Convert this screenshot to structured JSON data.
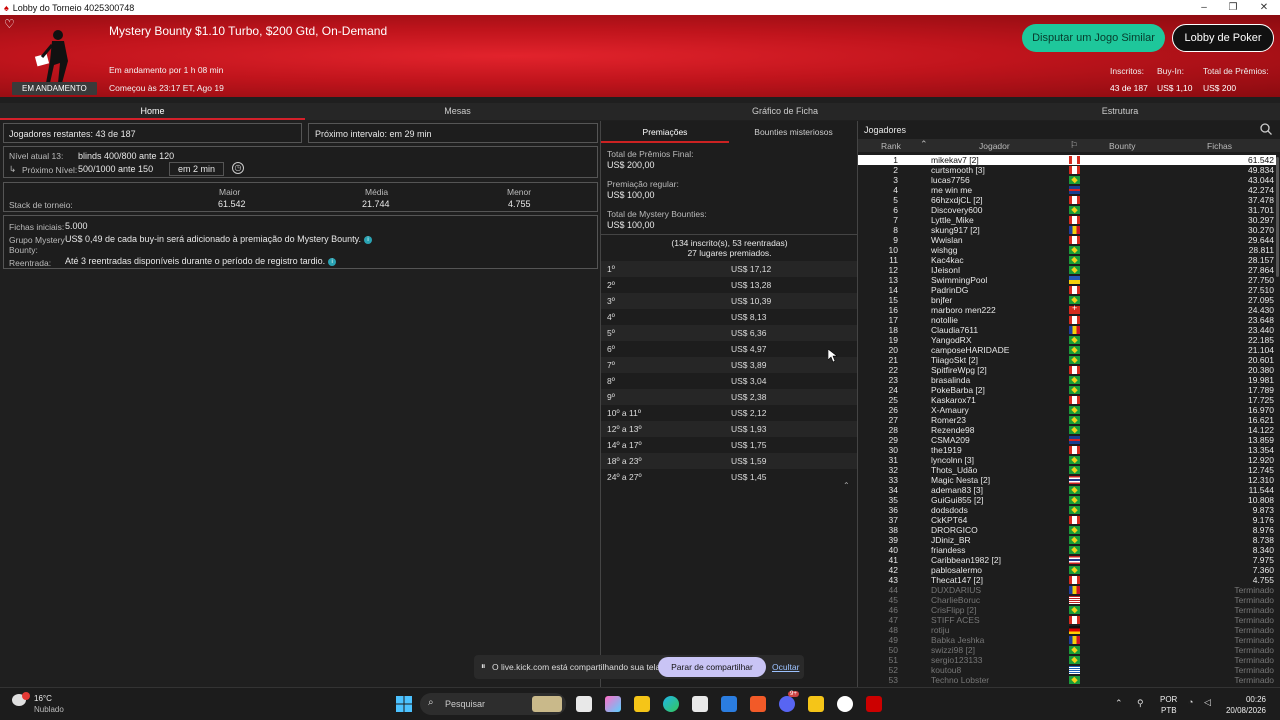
{
  "window": {
    "title": "Lobby do Torneio 4025300748"
  },
  "header": {
    "tournament_title": "Mystery Bounty $1.10 Turbo, $200 Gtd, On-Demand",
    "running_for": "Em andamento por 1 h 08 min",
    "started_at": "Começou às 23:17 ET, Ago 19",
    "status_badge": "EM ANDAMENTO",
    "similar_button": "Disputar um Jogo Similar",
    "poker_lobby_button": "Lobby de Poker",
    "stats": {
      "registered_label": "Inscritos:",
      "registered_value": "43 de 187",
      "buyin_label": "Buy-In:",
      "buyin_value": "US$ 1,10",
      "prize_label": "Total de Prêmios:",
      "prize_value": "US$ 200"
    }
  },
  "tabs": [
    "Home",
    "Mesas",
    "Gráfico de Ficha",
    "Estrutura"
  ],
  "home": {
    "players_remaining": "Jogadores restantes: 43 de 187",
    "next_break": "Próximo intervalo: em 29 min",
    "current_level_label": "Nível atual 13:",
    "current_level_value": "blinds 400/800 ante 120",
    "next_level_label": "Próximo Nível:",
    "next_level_value": "500/1000 ante 150",
    "next_level_time": "em 2 min",
    "stack_label": "Stack de torneio:",
    "stack_headers": [
      "Maior",
      "Média",
      "Menor"
    ],
    "stack_values": [
      "61.542",
      "21.744",
      "4.755"
    ],
    "initial_chips_label": "Fichas iniciais:",
    "initial_chips_value": "5.000",
    "mystery_label": "Grupo Mystery Bounty:",
    "mystery_value": "US$ 0,49 de cada buy-in será adicionado à premiação do Mystery Bounty.",
    "reentry_label": "Reentrada:",
    "reentry_value": "Até 3 reentradas disponíveis durante o período de registro tardio."
  },
  "prizes": {
    "tabs": [
      "Premiações",
      "Bounties misteriosos"
    ],
    "final_label": "Total de Prêmios Final:",
    "final_value": "US$ 200,00",
    "regular_label": "Premiação regular:",
    "regular_value": "US$ 100,00",
    "mystery_label": "Total de Mystery Bounties:",
    "mystery_value": "US$ 100,00",
    "entries_line": "(134 inscrito(s), 53 reentradas)",
    "paid_line": "27 lugares premiados.",
    "rows": [
      [
        "1º",
        "US$ 17,12"
      ],
      [
        "2º",
        "US$ 13,28"
      ],
      [
        "3º",
        "US$ 10,39"
      ],
      [
        "4º",
        "US$ 8,13"
      ],
      [
        "5º",
        "US$ 6,36"
      ],
      [
        "6º",
        "US$ 4,97"
      ],
      [
        "7º",
        "US$ 3,89"
      ],
      [
        "8º",
        "US$ 3,04"
      ],
      [
        "9º",
        "US$ 2,38"
      ],
      [
        "10º a 11º",
        "US$ 2,12"
      ],
      [
        "12º a 13º",
        "US$ 1,93"
      ],
      [
        "14º a 17º",
        "US$ 1,75"
      ],
      [
        "18º a 23º",
        "US$ 1,59"
      ],
      [
        "24º a 27º",
        "US$ 1,45"
      ]
    ]
  },
  "players": {
    "title": "Jogadores",
    "headers": {
      "rank": "Rank",
      "player": "Jogador",
      "bounty": "Bounty",
      "chips": "Fichas"
    },
    "rows": [
      [
        "1",
        "mikekav7 [2]",
        "ca",
        "61.542"
      ],
      [
        "2",
        "curtsmooth [3]",
        "ca",
        "49.834"
      ],
      [
        "3",
        "lucas7756",
        "br",
        "43.044"
      ],
      [
        "4",
        "me win me",
        "gb",
        "42.274"
      ],
      [
        "5",
        "66hzxdjCL [2]",
        "ca",
        "37.478"
      ],
      [
        "6",
        "Discovery600",
        "br",
        "31.701"
      ],
      [
        "7",
        "Lyttle_Mike",
        "ca",
        "30.297"
      ],
      [
        "8",
        "skung917 [2]",
        "ro",
        "30.270"
      ],
      [
        "9",
        "Wwislan",
        "ca",
        "29.644"
      ],
      [
        "10",
        "wishgg",
        "br",
        "28.811"
      ],
      [
        "11",
        "Kac4kac",
        "br",
        "28.157"
      ],
      [
        "12",
        "IJeisonI",
        "br",
        "27.864"
      ],
      [
        "13",
        "SwimmingPool",
        "ua",
        "27.750"
      ],
      [
        "14",
        "PadrinDG",
        "ca",
        "27.510"
      ],
      [
        "15",
        "bnjfer",
        "br",
        "27.095"
      ],
      [
        "16",
        "marboro men222",
        "ch",
        "24.430"
      ],
      [
        "17",
        "notollie",
        "ca",
        "23.648"
      ],
      [
        "18",
        "Claudia7611",
        "ro",
        "23.440"
      ],
      [
        "19",
        "YangodRX",
        "br",
        "22.185"
      ],
      [
        "20",
        "camposeHARIDADE",
        "br",
        "21.104"
      ],
      [
        "21",
        "TiiagoSkt [2]",
        "br",
        "20.601"
      ],
      [
        "22",
        "SpitfireWpg [2]",
        "ca",
        "20.380"
      ],
      [
        "23",
        "brasalinda",
        "br",
        "19.981"
      ],
      [
        "24",
        "PokeBarba [2]",
        "br",
        "17.789"
      ],
      [
        "25",
        "Kaskarox71",
        "ca",
        "17.725"
      ],
      [
        "26",
        "X-Amaury",
        "br",
        "16.970"
      ],
      [
        "27",
        "Romer23",
        "br",
        "16.621"
      ],
      [
        "28",
        "Rezende98",
        "br",
        "14.122"
      ],
      [
        "29",
        "CSMA209",
        "gb",
        "13.859"
      ],
      [
        "30",
        "the1919",
        "ca",
        "13.354"
      ],
      [
        "31",
        "lyncolnn [3]",
        "br",
        "12.920"
      ],
      [
        "32",
        "Thots_Udão",
        "br",
        "12.745"
      ],
      [
        "33",
        "Magic Nesta [2]",
        "th",
        "12.310"
      ],
      [
        "34",
        "ademan83 [3]",
        "br",
        "11.544"
      ],
      [
        "35",
        "GuiGui855 [2]",
        "br",
        "10.808"
      ],
      [
        "36",
        "dodsdods",
        "br",
        "9.873"
      ],
      [
        "37",
        "CkKPT64",
        "ca",
        "9.176"
      ],
      [
        "38",
        "DRORGICO",
        "br",
        "8.976"
      ],
      [
        "39",
        "JDiniz_BR",
        "br",
        "8.738"
      ],
      [
        "40",
        "friandess",
        "br",
        "8.340"
      ],
      [
        "41",
        "Caribbean1982 [2]",
        "th",
        "7.975"
      ],
      [
        "42",
        "pablosalermo",
        "br",
        "7.360"
      ],
      [
        "43",
        "Thecat147 [2]",
        "ca",
        "4.755"
      ],
      [
        "44",
        "DUXDARIUS",
        "ro",
        "Terminado"
      ],
      [
        "45",
        "CharlieBoruc",
        "us",
        "Terminado"
      ],
      [
        "46",
        "CrisFlipp [2]",
        "br",
        "Terminado"
      ],
      [
        "47",
        "STIFF ACES",
        "ca",
        "Terminado"
      ],
      [
        "48",
        "rotiju",
        "de",
        "Terminado"
      ],
      [
        "49",
        "Babka Jeshka",
        "ro",
        "Terminado"
      ],
      [
        "50",
        "swizzi98 [2]",
        "br",
        "Terminado"
      ],
      [
        "51",
        "sergio123133",
        "br",
        "Terminado"
      ],
      [
        "52",
        "koutou8",
        "gr",
        "Terminado"
      ],
      [
        "53",
        "Techno Lobster",
        "br",
        "Terminado"
      ]
    ]
  },
  "share_bar": {
    "message": "O live.kick.com está compartilhando sua tela.",
    "stop_button": "Parar de compartilhar",
    "hide_link": "Ocultar"
  },
  "taskbar": {
    "weather_temp": "16°C",
    "weather_desc": "Nublado",
    "search_placeholder": "Pesquisar",
    "lang_top": "POR",
    "lang_bottom": "PTB",
    "time": "00:26",
    "date": "20/08/2026",
    "badge_count": "9+"
  }
}
